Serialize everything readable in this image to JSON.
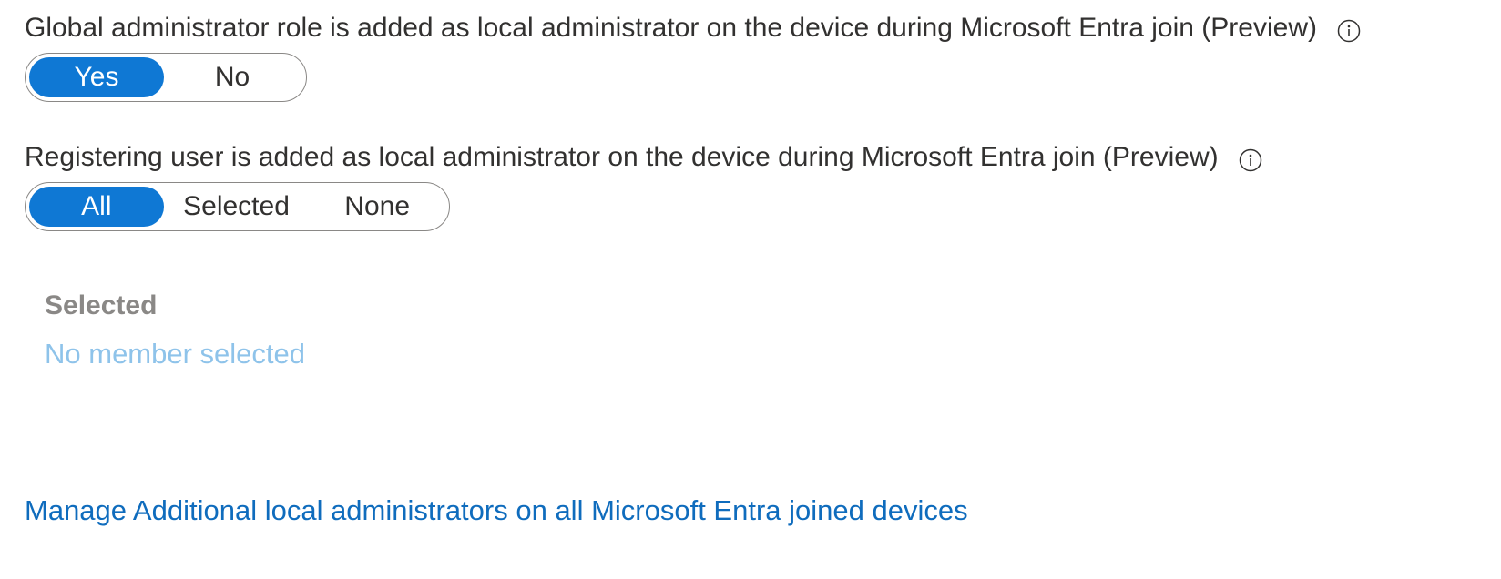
{
  "global_admin_setting": {
    "label": "Global administrator role is added as local administrator on the device during Microsoft Entra join (Preview)",
    "info_icon": "info-icon",
    "options": [
      "Yes",
      "No"
    ],
    "selected": "Yes"
  },
  "registering_user_setting": {
    "label": "Registering user is added as local administrator on the device during Microsoft Entra join (Preview)",
    "info_icon": "info-icon",
    "options": [
      "All",
      "Selected",
      "None"
    ],
    "selected": "All"
  },
  "selected_section": {
    "heading": "Selected",
    "member_link": "No member selected"
  },
  "manage_link": "Manage Additional local administrators on all Microsoft Entra joined devices",
  "colors": {
    "accent": "#0f78d4",
    "link": "#0f6cbd",
    "disabled_link": "#8ec3ea",
    "muted_heading": "#8a8886"
  }
}
